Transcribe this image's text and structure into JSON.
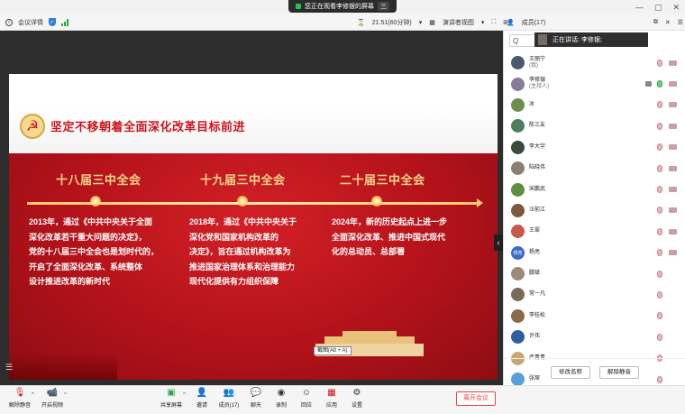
{
  "banner": {
    "text": "您正在观看李修银的屏幕",
    "badge": "三"
  },
  "window_controls": {
    "minimize": "—",
    "restore": "▢",
    "close": "✕"
  },
  "toolbar": {
    "meeting_info": "会议详情",
    "timer": "21:51(60分钟)",
    "view_mode": "演讲者视图",
    "members_label": "成员(17)"
  },
  "slide": {
    "title": "坚定不移朝着全面深化改革目标前进",
    "eras": [
      {
        "heading": "十八届三中全会",
        "lines": [
          "2013年，通过《中共中央关于全面",
          "深化改革若干重大问题的决定》，",
          "党的十八届三中全会也是划时代的，",
          "开启了全面深化改革、系统整体",
          "设计推进改革的新时代"
        ]
      },
      {
        "heading": "十九届三中全会",
        "lines": [
          "2018年，通过《中共中央关于",
          "深化党和国家机构改革的",
          "决定》，旨在通过机构改革为",
          "推进国家治理体系和治理能力",
          "现代化提供有力组织保障"
        ]
      },
      {
        "heading": "二十届三中全会",
        "lines": [
          "2024年，新的历史起点上进一步",
          "全面深化改革、推进中国式现代",
          "化的总动员、总部署"
        ]
      }
    ],
    "snip_tooltip": "截图(Alt + A)"
  },
  "panel": {
    "search_icon": "Q",
    "speaking": "正在讲话:  李修银;",
    "participants": [
      {
        "name": "王丽宁",
        "sub": "(我)",
        "color": "#4a5a6e",
        "mic": "muted",
        "cam": true
      },
      {
        "name": "李修银",
        "sub": "(主持人)",
        "color": "#8a7a9a",
        "mic": "active",
        "cam": true,
        "sharing": true
      },
      {
        "name": "冰",
        "sub": "",
        "color": "#6e8e4e",
        "mic": "muted",
        "cam": true
      },
      {
        "name": "陈三友",
        "sub": "",
        "color": "#4e7e5e",
        "mic": "muted",
        "cam": true
      },
      {
        "name": "李大宇",
        "sub": "",
        "color": "#3a4a3a",
        "mic": "muted",
        "cam": true
      },
      {
        "name": "陆晓伟",
        "sub": "",
        "color": "#8a8070",
        "mic": "muted",
        "cam": true
      },
      {
        "name": "宋鹏武",
        "sub": "",
        "color": "#5e8e3e",
        "mic": "muted",
        "cam": true
      },
      {
        "name": "汪前江",
        "sub": "",
        "color": "#7a5a3a",
        "mic": "muted",
        "cam": true
      },
      {
        "name": "王翠",
        "sub": "",
        "color": "#c85a4a",
        "mic": "muted",
        "cam": true
      },
      {
        "name": "杨亮",
        "sub": "",
        "color": "#3a6ac8",
        "mic": "muted",
        "cam": true,
        "avatar_text": "杨亮"
      },
      {
        "name": "滕斌",
        "sub": "",
        "color": "#9a8a7a",
        "mic": "muted",
        "cam": false
      },
      {
        "name": "常一凡",
        "sub": "",
        "color": "#7a6a5a",
        "mic": "muted",
        "cam": false
      },
      {
        "name": "李桂松",
        "sub": "",
        "color": "#8a6a4a",
        "mic": "muted",
        "cam": false
      },
      {
        "name": "许伟",
        "sub": "",
        "color": "#2e5e9e",
        "mic": "muted",
        "cam": false
      },
      {
        "name": "严青青",
        "sub": "",
        "color": "#c8a870",
        "mic": "muted",
        "cam": false
      },
      {
        "name": "张琛",
        "sub": "",
        "color": "#5aa0d8",
        "mic": "muted",
        "cam": false
      }
    ],
    "rename_button": "修改名称",
    "unmute_button": "解除静音"
  },
  "bottombar": {
    "unmute": "解除静音",
    "start_video": "开启视频",
    "share_screen": "共享屏幕",
    "invite": "邀请",
    "members": "成员(17)",
    "chat": "聊天",
    "record": "录制",
    "reactions": "回应",
    "apps": "应用",
    "settings": "设置",
    "leave": "离开会议"
  }
}
